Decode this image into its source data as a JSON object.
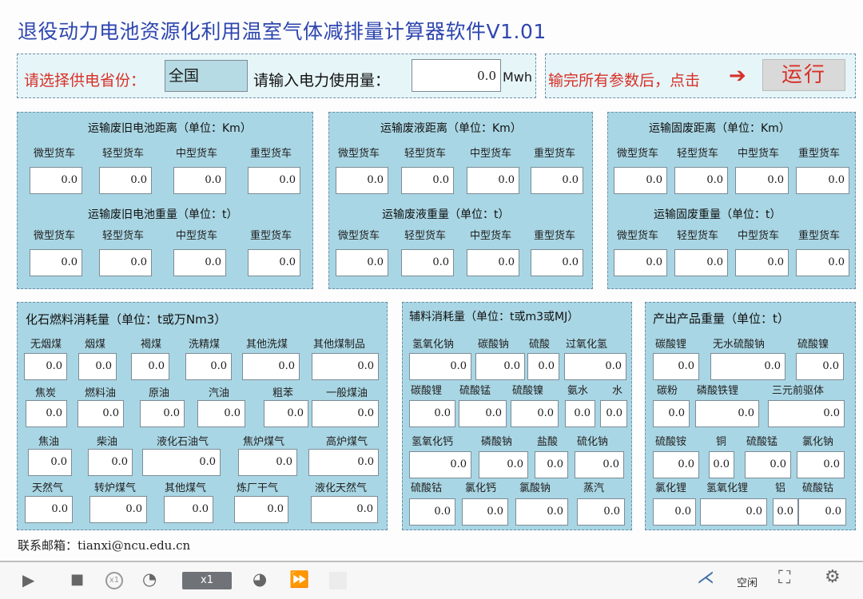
{
  "title": "退役动力电池资源化利用温室气体减排量计算器软件V1.01",
  "top": {
    "province_label": "请选择供电省份：",
    "province_value": "全国",
    "power_label": "请输入电力使用量：",
    "power_value": "0.0",
    "power_unit": "Mwh",
    "run_hint": "输完所有参数后，点击",
    "run_label": "运行"
  },
  "truck_labels": [
    "微型货车",
    "轻型货车",
    "中型货车",
    "重型货车"
  ],
  "transport": [
    {
      "dist_title": "运输废旧电池距离（单位：Km）",
      "dist_values": [
        "0.0",
        "0.0",
        "0.0",
        "0.0"
      ],
      "wt_title": "运输废旧电池重量（单位：t）",
      "wt_values": [
        "0.0",
        "0.0",
        "0.0",
        "0.0"
      ]
    },
    {
      "dist_title": "运输废液距离（单位：Km）",
      "dist_values": [
        "0.0",
        "0.0",
        "0.0",
        "0.0"
      ],
      "wt_title": "运输废液重量（单位：t）",
      "wt_values": [
        "0.0",
        "0.0",
        "0.0",
        "0.0"
      ]
    },
    {
      "dist_title": "运输固废距离（单位：Km）",
      "dist_values": [
        "0.0",
        "0.0",
        "0.0",
        "0.0"
      ],
      "wt_title": "运输固废重量（单位：t）",
      "wt_values": [
        "0.0",
        "0.0",
        "0.0",
        "0.0"
      ]
    }
  ],
  "fossil": {
    "title": "化石燃料消耗量（单位：t或万Nm3）",
    "rows": [
      [
        {
          "label": "无烟煤",
          "value": "0.0"
        },
        {
          "label": "烟煤",
          "value": "0.0"
        },
        {
          "label": "褐煤",
          "value": "0.0"
        },
        {
          "label": "洗精煤",
          "value": "0.0"
        },
        {
          "label": "其他洗煤",
          "value": "0.0"
        },
        {
          "label": "其他煤制品",
          "value": "0.0"
        }
      ],
      [
        {
          "label": "焦炭",
          "value": "0.0"
        },
        {
          "label": "燃料油",
          "value": "0.0"
        },
        {
          "label": "原油",
          "value": "0.0"
        },
        {
          "label": "汽油",
          "value": "0.0"
        },
        {
          "label": "粗苯",
          "value": "0.0"
        },
        {
          "label": "一般煤油",
          "value": "0.0"
        }
      ],
      [
        {
          "label": "焦油",
          "value": "0.0"
        },
        {
          "label": "柴油",
          "value": "0.0"
        },
        {
          "label": "液化石油气",
          "value": "0.0"
        },
        {
          "label": "焦炉煤气",
          "value": "0.0"
        },
        {
          "label": "高炉煤气",
          "value": "0.0"
        }
      ],
      [
        {
          "label": "天然气",
          "value": "0.0"
        },
        {
          "label": "转炉煤气",
          "value": "0.0"
        },
        {
          "label": "其他煤气",
          "value": "0.0"
        },
        {
          "label": "炼厂干气",
          "value": "0.0"
        },
        {
          "label": "液化天然气",
          "value": "0.0"
        }
      ]
    ]
  },
  "aux": {
    "title": "辅料消耗量（单位：t或m3或MJ）",
    "rows": [
      [
        {
          "label": "氢氧化钠",
          "value": "0.0"
        },
        {
          "label": "碳酸钠",
          "value": "0.0"
        },
        {
          "label": "硫酸",
          "value": "0.0"
        },
        {
          "label": "过氧化氢",
          "value": "0.0"
        }
      ],
      [
        {
          "label": "碳酸锂",
          "value": "0.0"
        },
        {
          "label": "硫酸锰",
          "value": "0.0"
        },
        {
          "label": "硫酸镍",
          "value": "0.0"
        },
        {
          "label": "氨水",
          "value": "0.0"
        },
        {
          "label": "水",
          "value": "0.0"
        }
      ],
      [
        {
          "label": "氢氧化钙",
          "value": "0.0"
        },
        {
          "label": "磷酸钠",
          "value": "0.0"
        },
        {
          "label": "盐酸",
          "value": "0.0"
        },
        {
          "label": "硫化钠",
          "value": "0.0"
        }
      ],
      [
        {
          "label": "硫酸钴",
          "value": "0.0"
        },
        {
          "label": "氯化钙",
          "value": "0.0"
        },
        {
          "label": "氯酸钠",
          "value": "0.0"
        },
        {
          "label": "蒸汽",
          "value": "0.0"
        }
      ]
    ]
  },
  "product": {
    "title": "产出产品重量（单位：t）",
    "rows": [
      [
        {
          "label": "碳酸锂",
          "value": "0.0"
        },
        {
          "label": "无水硫酸钠",
          "value": "0.0"
        },
        {
          "label": "硫酸镍",
          "value": "0.0"
        }
      ],
      [
        {
          "label": "碳粉",
          "value": "0.0"
        },
        {
          "label": "磷酸铁锂",
          "value": "0.0"
        },
        {
          "label": "三元前驱体",
          "value": "0.0"
        }
      ],
      [
        {
          "label": "硫酸铵",
          "value": "0.0"
        },
        {
          "label": "铜",
          "value": "0.0"
        },
        {
          "label": "硫酸锰",
          "value": "0.0"
        },
        {
          "label": "氯化钠",
          "value": "0.0"
        }
      ],
      [
        {
          "label": "氯化锂",
          "value": "0.0"
        },
        {
          "label": "氢氧化锂",
          "value": "0.0"
        },
        {
          "label": "铝",
          "value": "0.0"
        },
        {
          "label": "硫酸钴",
          "value": "0.0"
        }
      ]
    ]
  },
  "footer": {
    "email_label": "联系邮箱：",
    "email": "tianxi@ncu.edu.cn"
  },
  "toolbar": {
    "speed": "x1",
    "status": "空闲"
  }
}
